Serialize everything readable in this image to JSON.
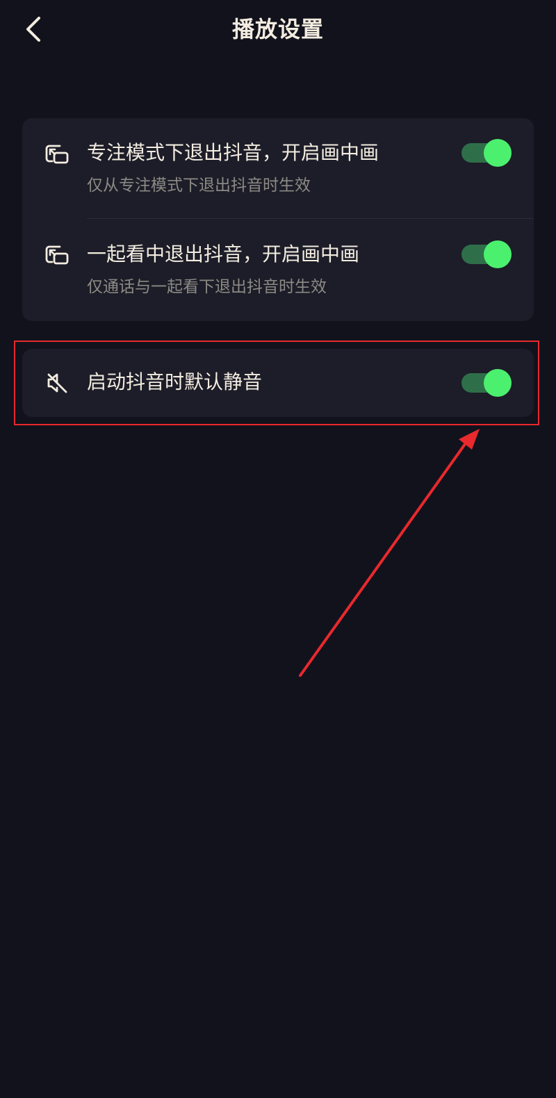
{
  "header": {
    "title": "播放设置",
    "back_icon": "chevron-left-icon"
  },
  "pip_card": {
    "items": [
      {
        "icon": "picture-in-picture-icon",
        "title": "专注模式下退出抖音，开启画中画",
        "subtitle": "仅从专注模式下退出抖音时生效",
        "enabled": true
      },
      {
        "icon": "picture-in-picture-icon",
        "title": "一起看中退出抖音，开启画中画",
        "subtitle": "仅通话与一起看下退出抖音时生效",
        "enabled": true
      }
    ]
  },
  "mute_card": {
    "icon": "speaker-muted-icon",
    "title": "启动抖音时默认静音",
    "enabled": true
  },
  "colors": {
    "background": "#12121c",
    "card": "#1c1d28",
    "toggle_on_knob": "#4cf06f",
    "toggle_on_track": "#2e6f49",
    "annotation": "#e8292d"
  }
}
